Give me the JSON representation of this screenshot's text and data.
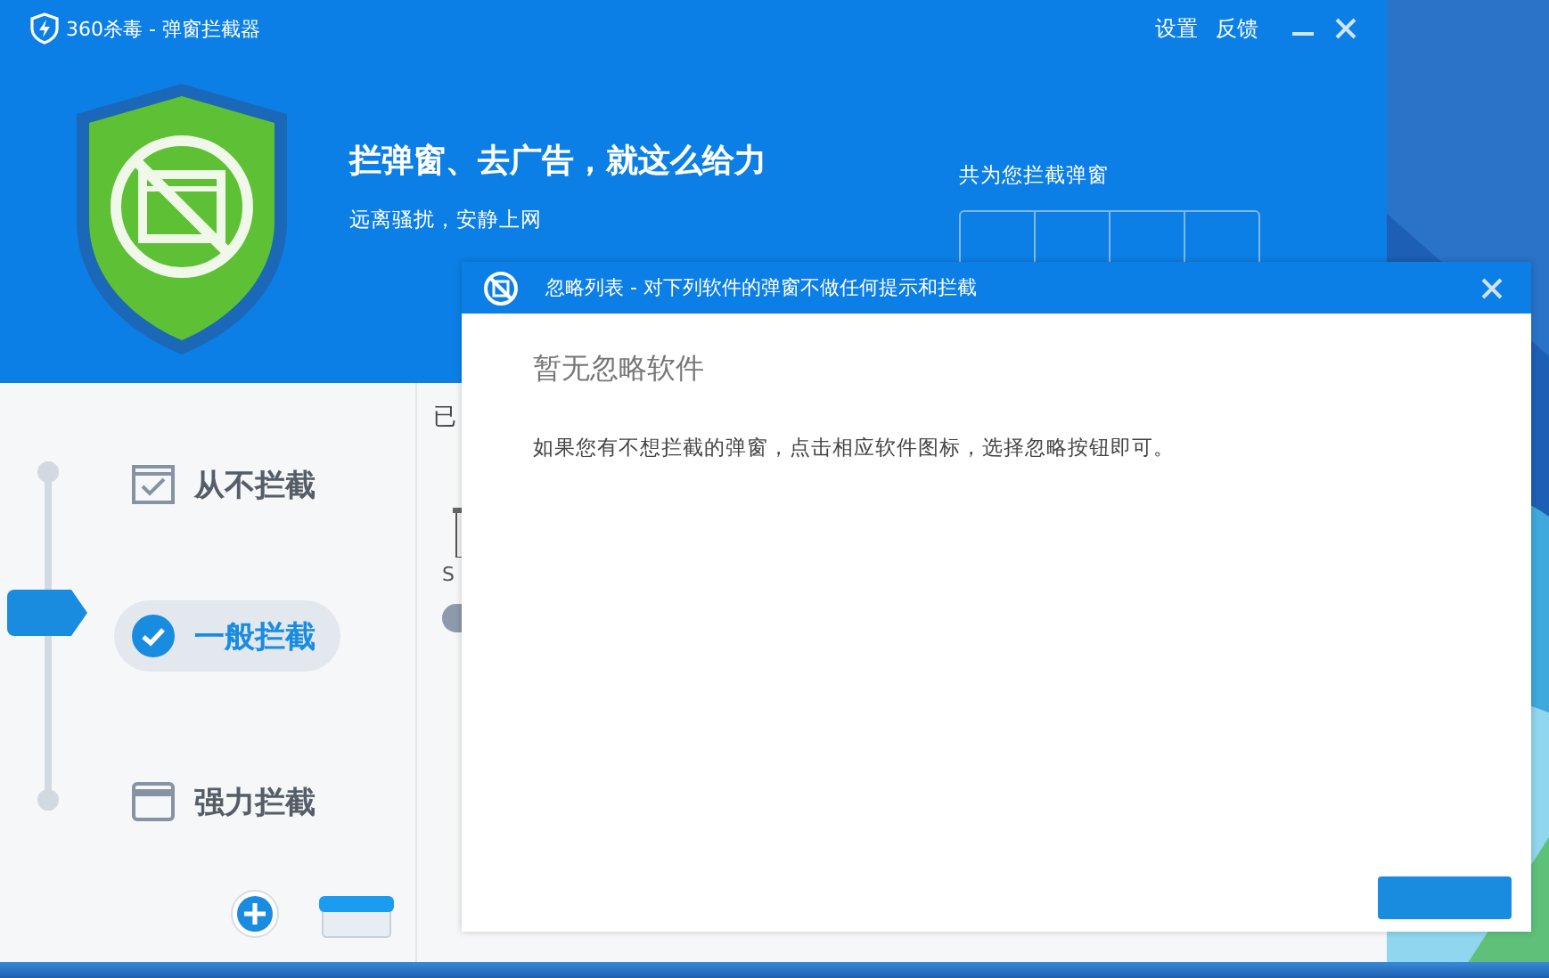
{
  "window": {
    "title": "360杀毒 - 弹窗拦截器",
    "menu": [
      "设置",
      "反馈"
    ]
  },
  "banner": {
    "headline": "拦弹窗、去广告，就这么给力",
    "subline": "远离骚扰，安静上网",
    "counter_label": "共为您拦截弹窗"
  },
  "modes": [
    {
      "label": "从不拦截",
      "kind": "check",
      "selected": false
    },
    {
      "label": "一般拦截",
      "selected": true
    },
    {
      "label": "强力拦截",
      "kind": "window",
      "selected": false
    }
  ],
  "list_panel": {
    "heading": "已",
    "app_label": "S",
    "toggle_on": false
  },
  "dialog": {
    "title": "忽略列表 - 对下列软件的弹窗不做任何提示和拦截",
    "empty_title": "暂无忽略软件",
    "message": "如果您有不想拦截的弹窗，点击相应软件图标，选择忽略按钮即可。"
  }
}
